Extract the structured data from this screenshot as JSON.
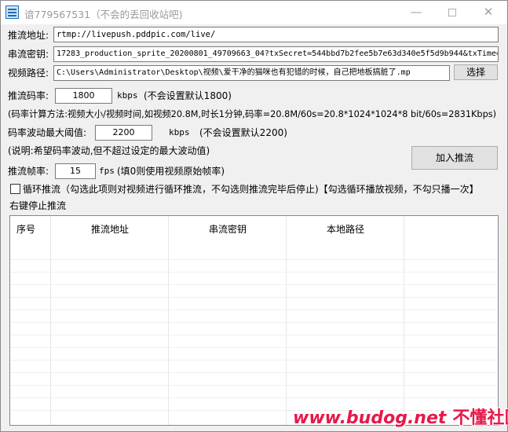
{
  "window": {
    "title": "谙779567531（不会的丢回收站吧)",
    "minimize": "—",
    "close": "✕"
  },
  "form": {
    "push_url_label": "推流地址:",
    "push_url_value": "rtmp://livepush.pddpic.com/live/",
    "stream_key_label": "串流密钥:",
    "stream_key_value": "17283_production_sprite_20200801_49709663_04?txSecret=544bbd7b2fee5b7e63d340e5f5d9b944&txTime=",
    "video_path_label": "视频路径:",
    "video_path_value": "C:\\Users\\Administrator\\Desktop\\视频\\爱干净的猫咪也有犯错的时候，自己把地板搞脏了.mp",
    "browse_button": "选择",
    "bitrate_label": "推流码率:",
    "bitrate_value": "1800",
    "bitrate_unit": "kbps",
    "bitrate_note": "(不会设置默认1800)",
    "bitrate_formula": "(码率计算方法:视频大小/视频时间,如视频20.8M,时长1分钟,码率=20.8M/60s=20.8*1024*1024*8 bit/60s=2831Kbps)",
    "max_threshold_label": "码率波动最大阈值:",
    "max_threshold_value": "2200",
    "max_threshold_unit": "kbps",
    "max_threshold_note": "(不会设置默认2200)",
    "threshold_explain": "(说明:希望码率波动,但不超过设定的最大波动值)",
    "add_push_button": "加入推流",
    "fps_label": "推流帧率:",
    "fps_value": "15",
    "fps_unit": "fps",
    "fps_note": "(填0则使用视频原始帧率)",
    "loop_label": "循环推流（勾选此项则对视频进行循环推流，不勾选则推流完毕后停止)【勾选循环播放视频，不勾只播一次】",
    "loop_checked": false,
    "stop_hint": "右键停止推流"
  },
  "table": {
    "columns": [
      "序号",
      "推流地址",
      "串流密钥",
      "本地路径",
      ""
    ],
    "rows": []
  },
  "watermark": {
    "site": "www.budog.net",
    "name": "不懂社区"
  }
}
